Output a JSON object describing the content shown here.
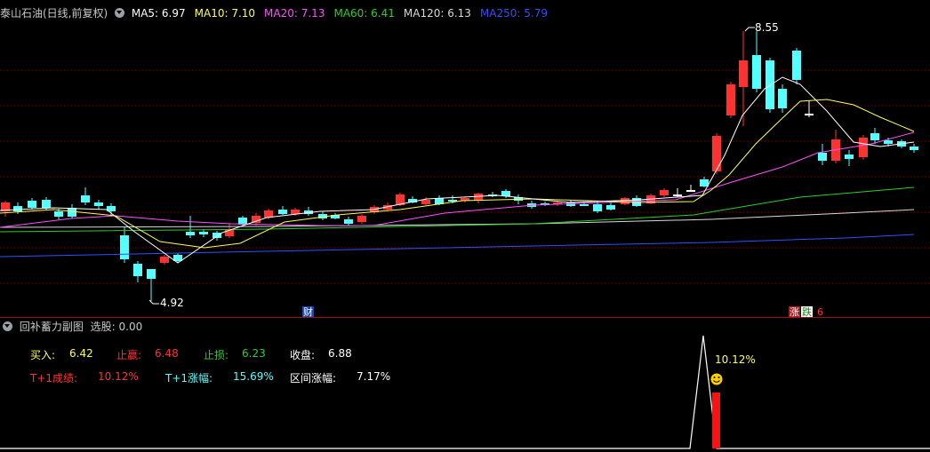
{
  "header": {
    "stock_title": "泰山石油(日线,前复权)",
    "ma": [
      {
        "label": "MA5: 6.97",
        "color": "#ffffff"
      },
      {
        "label": "MA10: 7.10",
        "color": "#ffff54"
      },
      {
        "label": "MA20: 7.13",
        "color": "#ff50ff"
      },
      {
        "label": "MA60: 6.41",
        "color": "#2ccf2c"
      },
      {
        "label": "MA120: 6.13",
        "color": "#d8d8d8"
      },
      {
        "label": "MA250: 5.79",
        "color": "#3050ff"
      }
    ]
  },
  "main_chart": {
    "max_label": "8.55",
    "min_label": "4.92",
    "badge_cai": "财",
    "badge_zhang": "涨",
    "badge_die": "跌",
    "badge_num": "6"
  },
  "sub_header": {
    "title": "回补蓄力副图",
    "xuangu": "选股: 0.00"
  },
  "sub_panel": {
    "buy_label": "买入:",
    "buy_value": "6.42",
    "take_profit_label": "止赢:",
    "take_profit_value": "6.48",
    "stop_loss_label": "止损:",
    "stop_loss_value": "6.23",
    "close_label": "收盘:",
    "close_value": "6.88",
    "t1_result_label": "T+1成绩:",
    "t1_result_value": "10.12%",
    "t1_change_label": "T+1涨幅:",
    "t1_change_value": "15.69%",
    "range_change_label": "区间涨幅:",
    "range_change_value": "7.17%",
    "signal_label": "10.12%",
    "signal_icon": "smiley-icon"
  },
  "colors": {
    "up": "#ff3232",
    "down": "#54ffff",
    "grid": "#8b0000",
    "buy": "#ffff54",
    "take_profit": "#ff3232",
    "stop_loss": "#2ccf2c",
    "close": "#ffffff",
    "t1_change": "#54ffff",
    "signal": "#ffff54"
  }
}
